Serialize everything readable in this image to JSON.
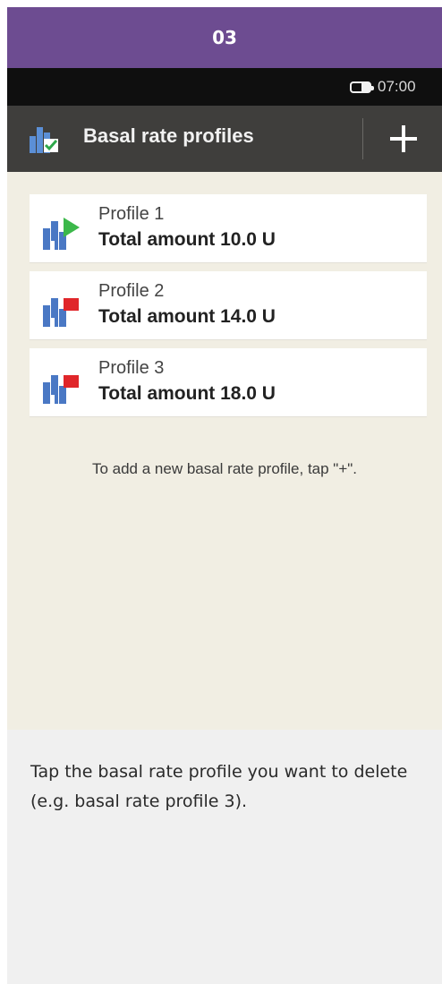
{
  "step": {
    "number": "03"
  },
  "status_bar": {
    "time": "07:00"
  },
  "title_bar": {
    "title": "Basal rate profiles",
    "add_icon": "plus-icon",
    "screen_icon": "basal-profiles-icon"
  },
  "profiles": [
    {
      "name": "Profile 1",
      "total": "Total amount 10.0 U",
      "status": "active",
      "marker_color": "#3cb84a"
    },
    {
      "name": "Profile 2",
      "total": "Total amount 14.0 U",
      "status": "inactive",
      "marker_color": "#e0262a"
    },
    {
      "name": "Profile 3",
      "total": "Total amount 18.0 U",
      "status": "inactive",
      "marker_color": "#e0262a"
    }
  ],
  "hint": "To add a new basal rate profile, tap \"+\".",
  "caption": "Tap the basal rate profile you want to delete (e.g. basal rate profile 3).",
  "colors": {
    "header": "#6d4c91",
    "title_bar": "#3f3e3c",
    "content_bg": "#f1eee3",
    "page_bg": "#f0f0f0"
  }
}
